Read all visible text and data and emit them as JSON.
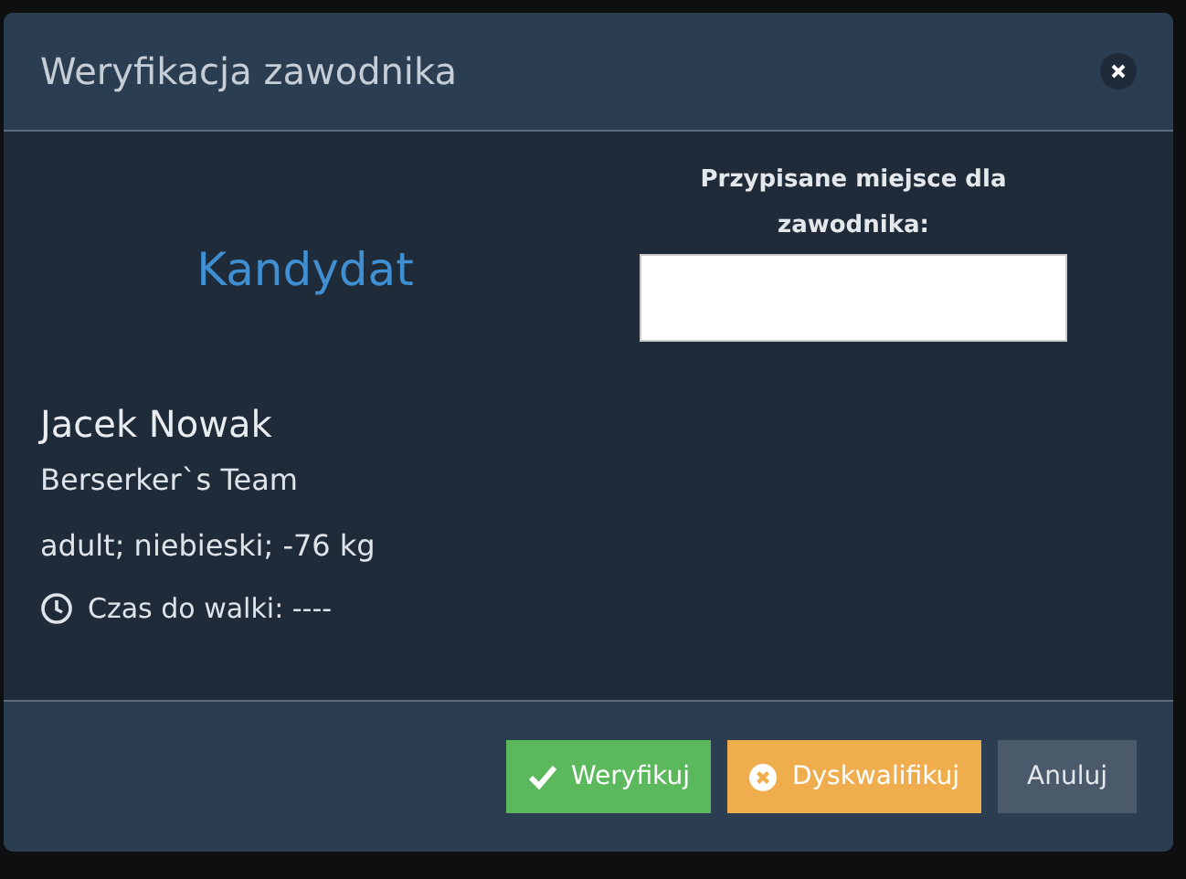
{
  "dialog": {
    "title": "Weryfikacja zawodnika",
    "status": "Kandydat",
    "place_label": "Przypisane miejsce dla zawodnika:",
    "competitor": {
      "name": "Jacek Nowak",
      "team": "Berserker`s Team",
      "details": "adult; niebieski; -76 kg",
      "time": "Czas do walki: ----"
    }
  },
  "buttons": [
    {
      "label": "Weryfikuj",
      "kind": "success"
    },
    {
      "label": "Dyskwalifikuj",
      "kind": "warning"
    },
    {
      "label": "Anuluj",
      "kind": "default"
    }
  ]
}
